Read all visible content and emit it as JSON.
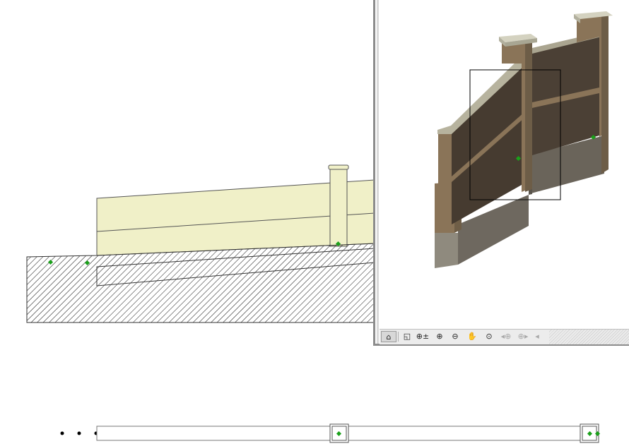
{
  "section_view": {
    "fill_color": "#f0f0c8",
    "hatch_color": "#111111",
    "hotspot_color": "#1aa01a"
  },
  "view3d": {
    "colors": {
      "panel": "#4a3f33",
      "panel_dark": "#3a3128",
      "pier": "#8a7458",
      "cap": "#c9c7b4",
      "base": "#8f8a7e"
    },
    "toolbar": {
      "buttons": [
        {
          "name": "view-mode-button",
          "icon": "view-mode-icon",
          "glyph": "⌂",
          "state": "active"
        },
        {
          "name": "fit-window-button",
          "icon": "fit-window-icon",
          "glyph": "◱",
          "state": "enabled"
        },
        {
          "name": "zoom-realtime-button",
          "icon": "zoom-realtime-icon",
          "glyph": "⊕±",
          "state": "enabled"
        },
        {
          "name": "zoom-in-button",
          "icon": "zoom-in-icon",
          "glyph": "⊕",
          "state": "enabled"
        },
        {
          "name": "zoom-out-button",
          "icon": "zoom-out-icon",
          "glyph": "⊖",
          "state": "enabled"
        },
        {
          "name": "pan-button",
          "icon": "hand-icon",
          "glyph": "✋",
          "state": "enabled"
        },
        {
          "name": "zoom-fit-button",
          "icon": "magnifier-icon",
          "glyph": "⊙",
          "state": "enabled"
        },
        {
          "name": "previous-zoom-button",
          "icon": "previous-zoom-icon",
          "glyph": "◂⊕",
          "state": "disabled"
        },
        {
          "name": "next-zoom-button",
          "icon": "next-zoom-icon",
          "glyph": "⊕▸",
          "state": "disabled"
        },
        {
          "name": "scroll-left-button",
          "icon": "scroll-left-icon",
          "glyph": "◂",
          "state": "disabled"
        }
      ]
    }
  },
  "plan_strip": {
    "dot_color": "#000000",
    "hotspot_color": "#1aa01a"
  }
}
